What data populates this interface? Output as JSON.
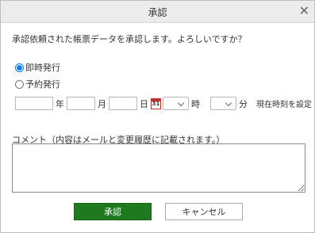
{
  "dialog": {
    "title": "承認",
    "close_symbol": "✕"
  },
  "message": "承認依頼された帳票データを承認します。よろしいですか？",
  "options": {
    "immediate_label": "即時発行",
    "scheduled_label": "予約発行",
    "selected": "immediate"
  },
  "schedule": {
    "year_unit": "年",
    "month_unit": "月",
    "day_unit": "日",
    "hour_unit": "時",
    "minute_unit": "分",
    "calendar_day": "31",
    "set_now_label": "現在時刻を設定"
  },
  "comment": {
    "label": "コメント（内容はメールと変更履歴に記載されます。）",
    "value": ""
  },
  "buttons": {
    "approve": "承認",
    "cancel": "キャンセル"
  },
  "colors": {
    "approve_bg": "#1f7a1f"
  }
}
